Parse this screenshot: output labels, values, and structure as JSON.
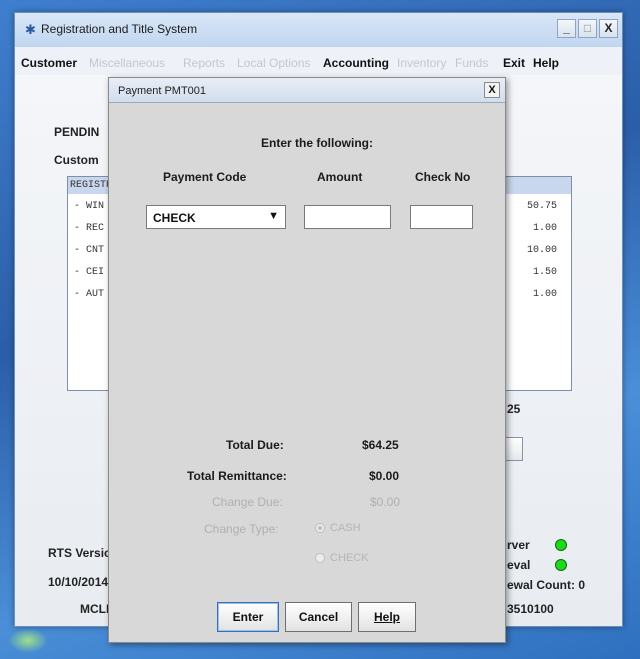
{
  "window": {
    "title": "Registration and Title System",
    "controls": {
      "minimize": "_",
      "maximize": "□",
      "close": "X"
    }
  },
  "menu": {
    "customer": "Customer",
    "miscellaneous": "Miscellaneous",
    "reports": "Reports",
    "local_options": "Local Options",
    "accounting": "Accounting",
    "inventory": "Inventory",
    "funds": "Funds",
    "exit": "Exit",
    "help": "Help"
  },
  "background": {
    "pending_label": "PENDIN",
    "customer_label": "Custom",
    "list_header": "REGISTR",
    "rows": [
      {
        "label": "- WIN",
        "amount": "50.75"
      },
      {
        "label": "- REC",
        "amount": "1.00"
      },
      {
        "label": "- CNT",
        "amount": "10.00"
      },
      {
        "label": "- CEI",
        "amount": "1.50"
      },
      {
        "label": "- AUT",
        "amount": "1.00"
      }
    ],
    "total_partial": "25",
    "rts_version_label": "RTS Version",
    "date": "10/10/2014",
    "user": "MCLE",
    "server_label": "rver",
    "renewal_label": "eval",
    "renewal_count": "ewal Count: 0",
    "id_number": "3510100",
    "status_color": "#1dd81d"
  },
  "dialog": {
    "title": "Payment  PMT001",
    "close": "X",
    "instruction": "Enter the following:",
    "col_payment_code": "Payment Code",
    "col_amount": "Amount",
    "col_check_no": "Check No",
    "payment_code_value": "CHECK",
    "amount_value": "",
    "check_no_value": "",
    "total_due_label": "Total Due:",
    "total_due_value": "$64.25",
    "total_remittance_label": "Total Remittance:",
    "total_remittance_value": "$0.00",
    "change_due_label": "Change Due:",
    "change_due_value": "$0.00",
    "change_type_label": "Change Type:",
    "change_type_options": [
      "CASH",
      "CHECK"
    ],
    "change_type_selected": "CASH",
    "buttons": {
      "enter": "Enter",
      "cancel": "Cancel",
      "help": "Help"
    }
  }
}
